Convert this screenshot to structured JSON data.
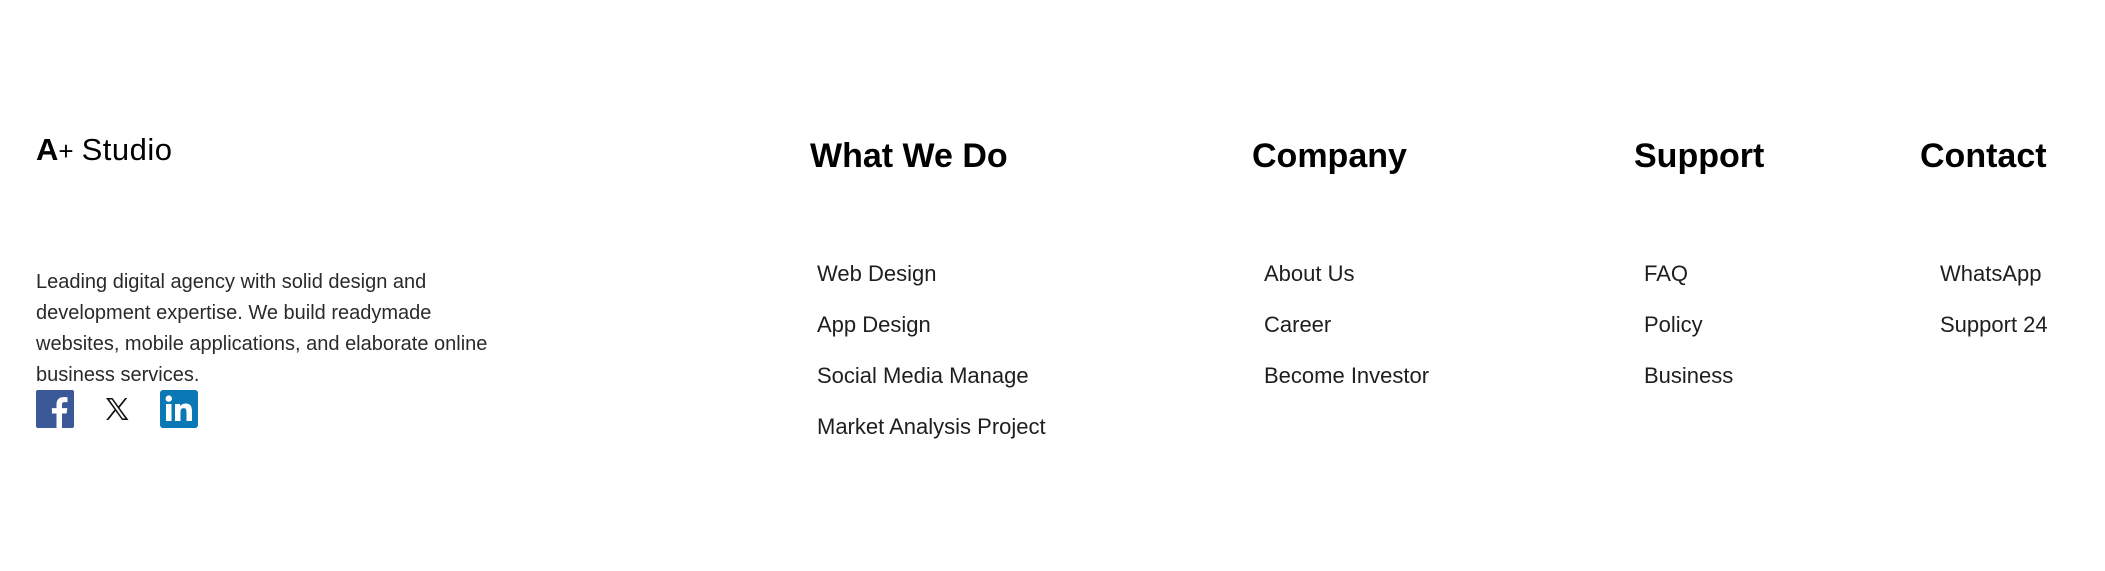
{
  "brand": {
    "mark": "A",
    "plus": "+",
    "name": "Studio"
  },
  "description": "Leading digital agency with solid design and development expertise. We build readymade websites, mobile applications, and elaborate online business services.",
  "social": [
    {
      "icon": "facebook-icon",
      "color": "#3b5998"
    },
    {
      "icon": "x-icon",
      "color": "#000000"
    },
    {
      "icon": "linkedin-icon",
      "color": "#0a66c2"
    }
  ],
  "columns": {
    "what_we_do": {
      "title": "What We Do",
      "items": [
        "Web Design",
        "App Design",
        "Social Media Manage",
        "Market Analysis Project"
      ]
    },
    "company": {
      "title": "Company",
      "items": [
        "About Us",
        "Career",
        "Become Investor"
      ]
    },
    "support": {
      "title": "Support",
      "items": [
        "FAQ",
        "Policy",
        "Business"
      ]
    },
    "contact": {
      "title": "Contact",
      "items": [
        "WhatsApp",
        "Support 24"
      ]
    }
  }
}
